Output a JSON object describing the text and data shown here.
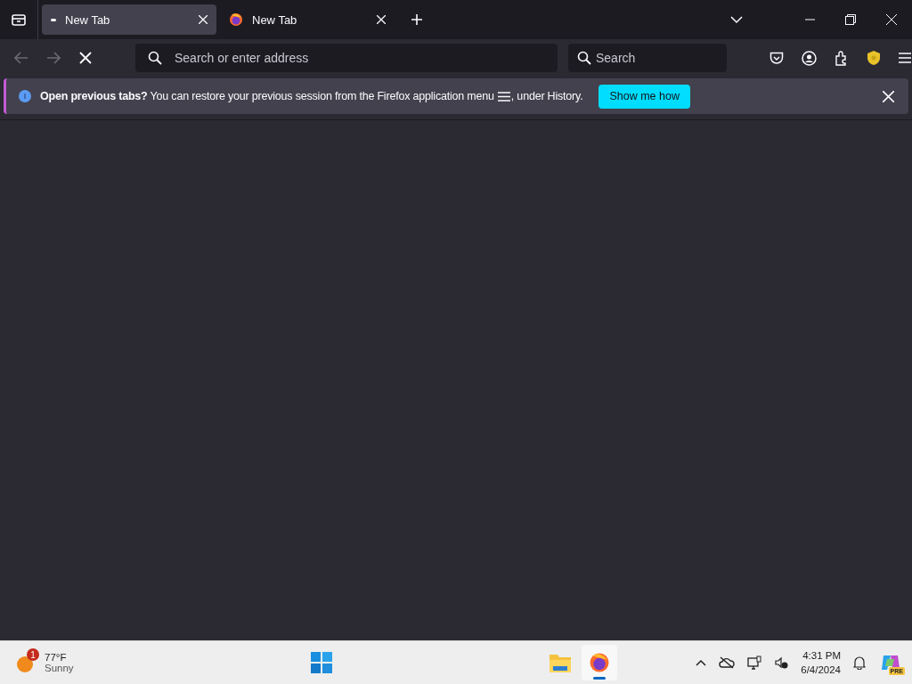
{
  "tabs": [
    {
      "label": "New Tab",
      "selected": true,
      "kind": "loading"
    },
    {
      "label": "New Tab",
      "selected": false,
      "kind": "firefox"
    }
  ],
  "address_bar": {
    "placeholder": "Search or enter address"
  },
  "search_bar": {
    "placeholder": "Search"
  },
  "notification": {
    "message": "**Open previous tabs?** You can restore your previous session from the Firefox application menu",
    "message_end": ", under History.",
    "button": "Show me how"
  },
  "taskbar": {
    "weather": {
      "badge": "1",
      "temperature": "77°F",
      "condition": "Sunny"
    },
    "apps": [
      {
        "kind": "files",
        "selected": false
      },
      {
        "kind": "firefox",
        "selected": true
      }
    ],
    "time": "4:31 PM",
    "date": "6/4/2024",
    "copilot_badge": "PRE"
  }
}
